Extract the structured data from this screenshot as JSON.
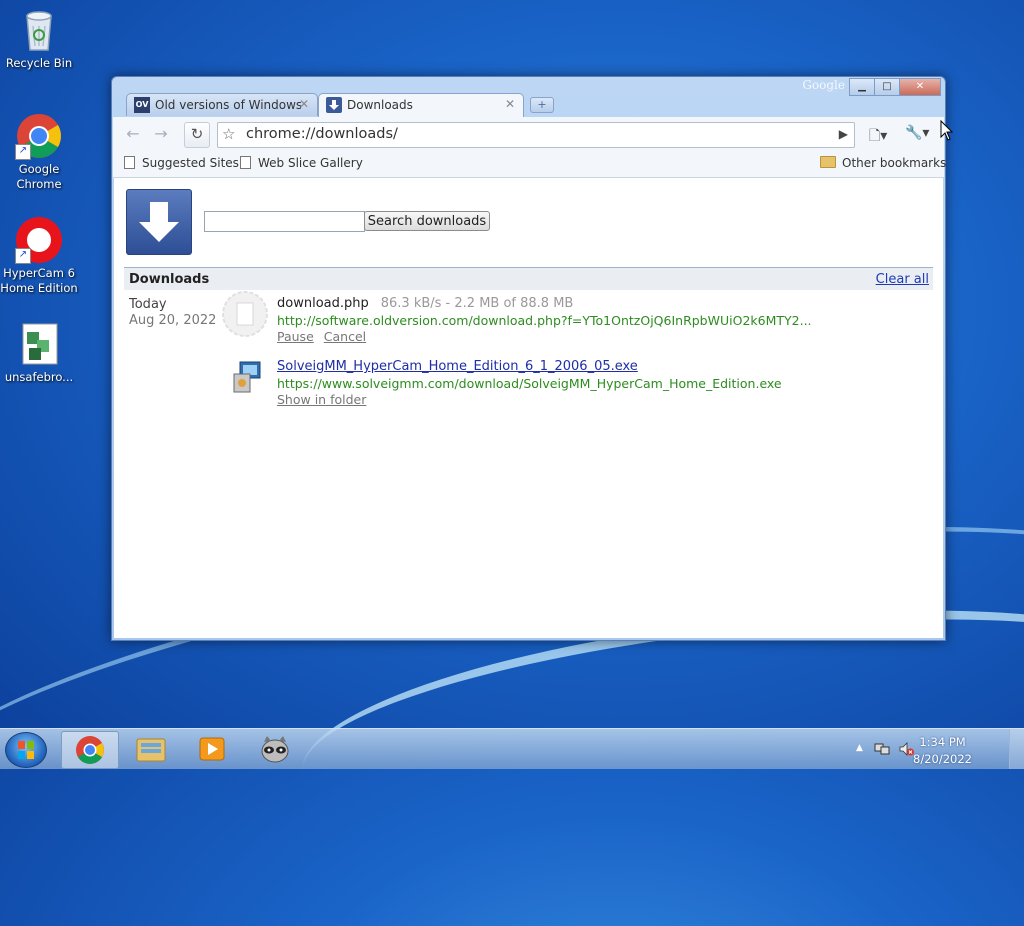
{
  "desktop": {
    "icons": [
      {
        "label_line1": "Recycle Bin",
        "label_line2": "",
        "icon": "recycle-bin-icon"
      },
      {
        "label_line1": "Google",
        "label_line2": "Chrome",
        "icon": "chrome-icon"
      },
      {
        "label_line1": "HyperCam 6",
        "label_line2": "Home Edition",
        "icon": "hypercam-icon"
      },
      {
        "label_line1": "unsafebro...",
        "label_line2": "",
        "icon": "installer-icon"
      }
    ]
  },
  "window": {
    "brand": "Google",
    "controls": {
      "minimize": "▁",
      "maximize": "□",
      "close": "✕"
    },
    "tabs": [
      {
        "label": "Old versions of Windows,...",
        "favicon_text": "OV",
        "close": "✕"
      },
      {
        "label": "Downloads",
        "close": "✕"
      }
    ],
    "new_tab": "+"
  },
  "toolbar": {
    "back": "←",
    "forward": "→",
    "reload": "↻",
    "star": "☆",
    "url": "chrome://downloads/",
    "go": "▶",
    "page_menu": "🗋▾",
    "wrench_menu": "🔧▾"
  },
  "bookmarks": {
    "items": [
      "Suggested Sites",
      "Web Slice Gallery"
    ],
    "other": "Other bookmarks"
  },
  "downloads_page": {
    "search_placeholder": "",
    "search_button": "Search downloads",
    "header_title": "Downloads",
    "clear_all": "Clear all",
    "date_label": "Today",
    "date_sub": "Aug 20, 2022",
    "items": [
      {
        "filename": "download.php",
        "status": "86.3 kB/s - 2.2 MB of 88.8 MB",
        "url": "http://software.oldversion.com/download.php?f=YTo1OntzOjQ6InRpbWUiO2k6MTY2...",
        "actions": [
          "Pause",
          "Cancel"
        ]
      },
      {
        "filename": "SolveigMM_HyperCam_Home_Edition_6_1_2006_05.exe",
        "status": "",
        "url": "https://www.solveigmm.com/download/SolveigMM_HyperCam_Home_Edition.exe",
        "actions": [
          "Show in folder"
        ]
      }
    ]
  },
  "taskbar": {
    "clock_time": "1:34 PM",
    "clock_date": "8/20/2022",
    "tray_arrow": "▲"
  }
}
